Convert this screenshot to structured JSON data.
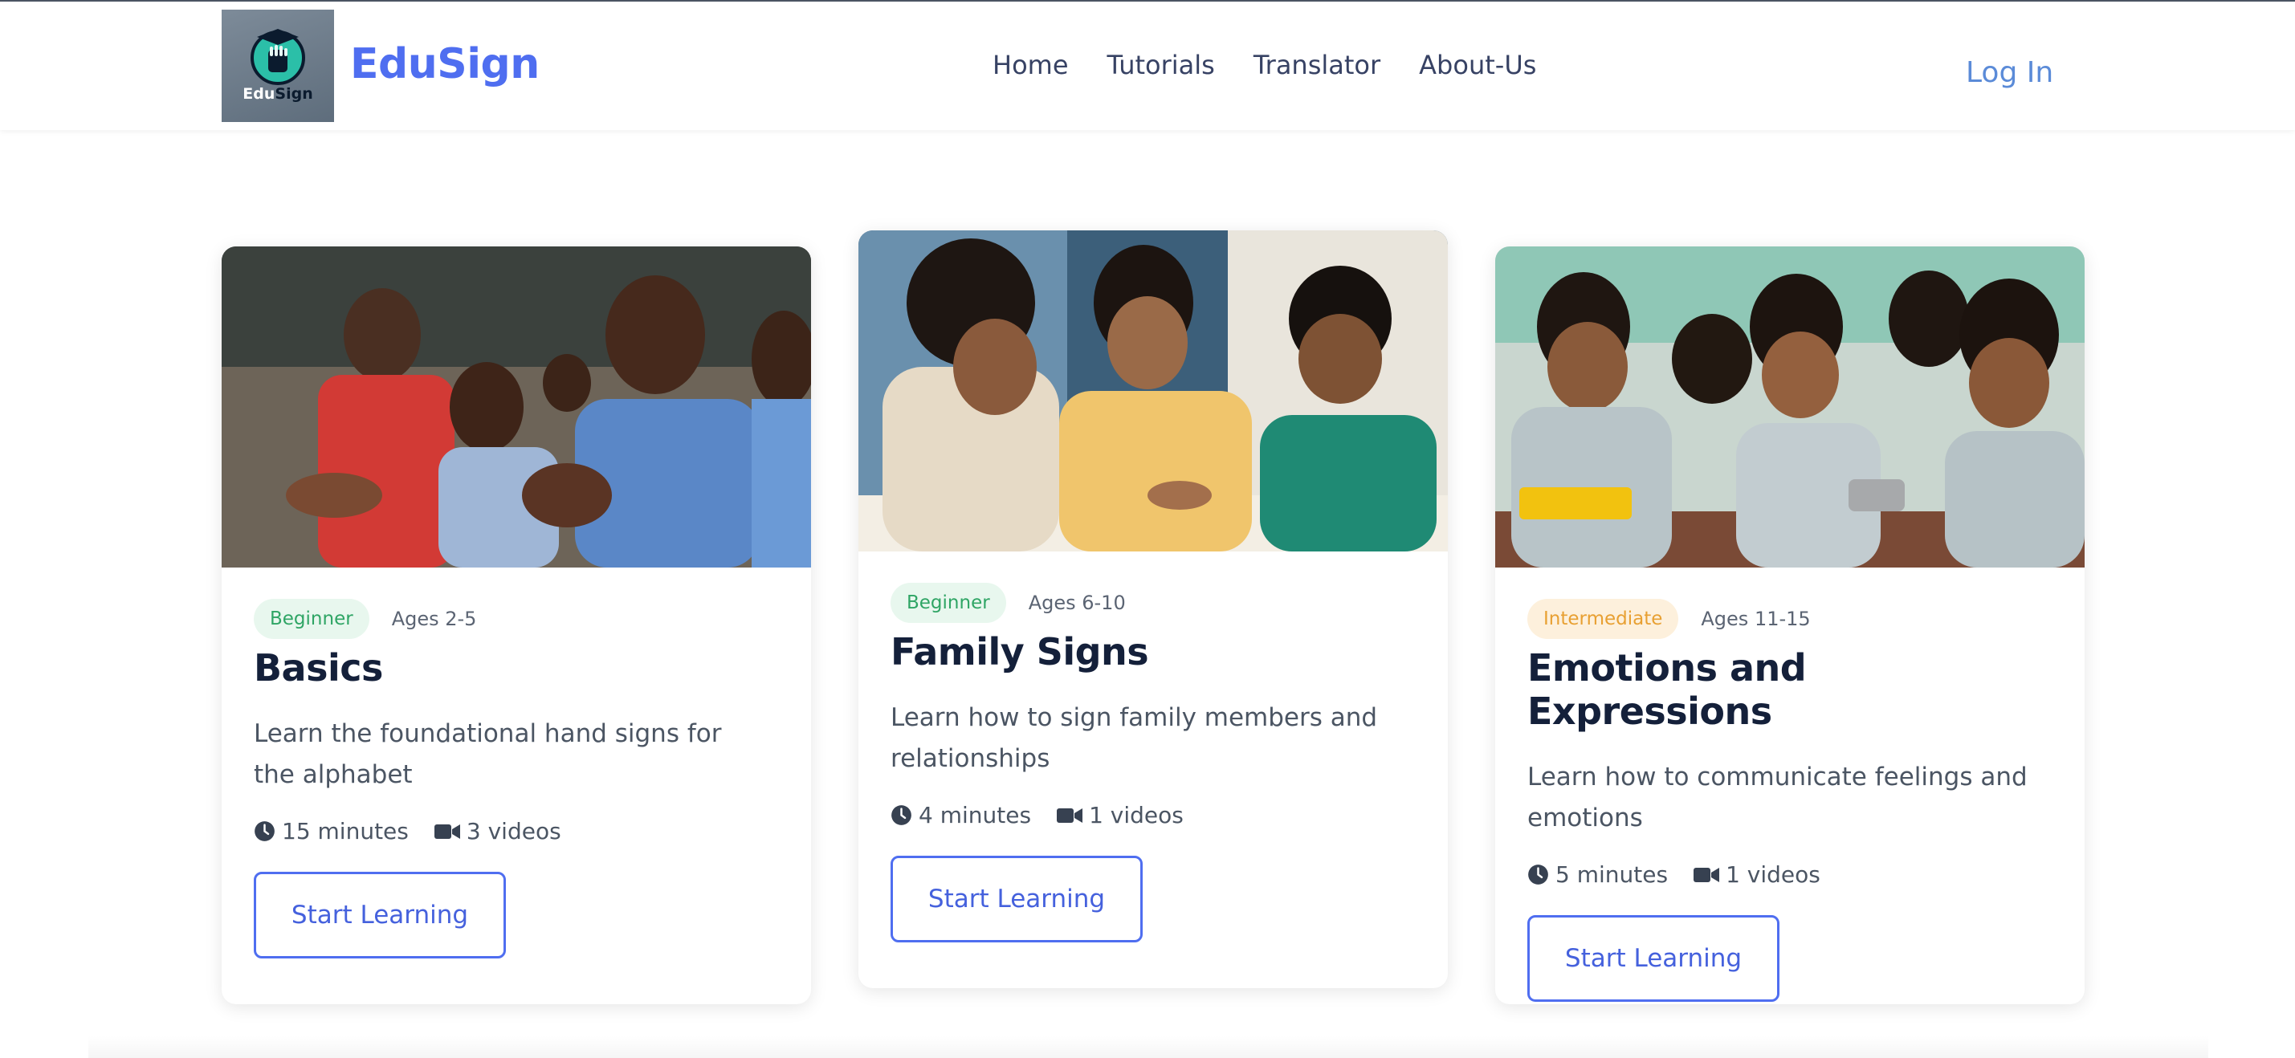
{
  "brand": {
    "logo_edu": "Edu",
    "logo_sign": "Sign",
    "name": "EduSign"
  },
  "nav": {
    "items": [
      "Home",
      "Tutorials",
      "Translator",
      "About-Us"
    ],
    "login": "Log In"
  },
  "colors": {
    "brand": "#4f6ef0",
    "login": "#5b8bd8",
    "beginner_bg": "#e8f7ee",
    "beginner_text": "#2fa565",
    "intermediate_bg": "#fdf0dc",
    "intermediate_text": "#e8a032"
  },
  "cards": [
    {
      "level": "Beginner",
      "ages": "Ages 2-5",
      "title": "Basics",
      "description": "Learn the foundational hand signs for the alphabet",
      "duration": "15 minutes",
      "videos": "3 videos",
      "button": "Start Learning",
      "photo": "classroom-children-photo"
    },
    {
      "level": "Beginner",
      "ages": "Ages 6-10",
      "title": "Family Signs",
      "description": "Learn how to sign family members and relationships",
      "duration": "4 minutes",
      "videos": "1 videos",
      "button": "Start Learning",
      "photo": "teacher-with-children-photo"
    },
    {
      "level": "Intermediate",
      "ages": "Ages 11-15",
      "title": "Emotions and Expressions",
      "description": "Learn how to communicate feelings and emotions",
      "duration": "5 minutes",
      "videos": "1 videos",
      "button": "Start Learning",
      "photo": "students-laughing-photo"
    }
  ],
  "icons": {
    "clock": "clock-icon",
    "video": "video-camera-icon"
  }
}
